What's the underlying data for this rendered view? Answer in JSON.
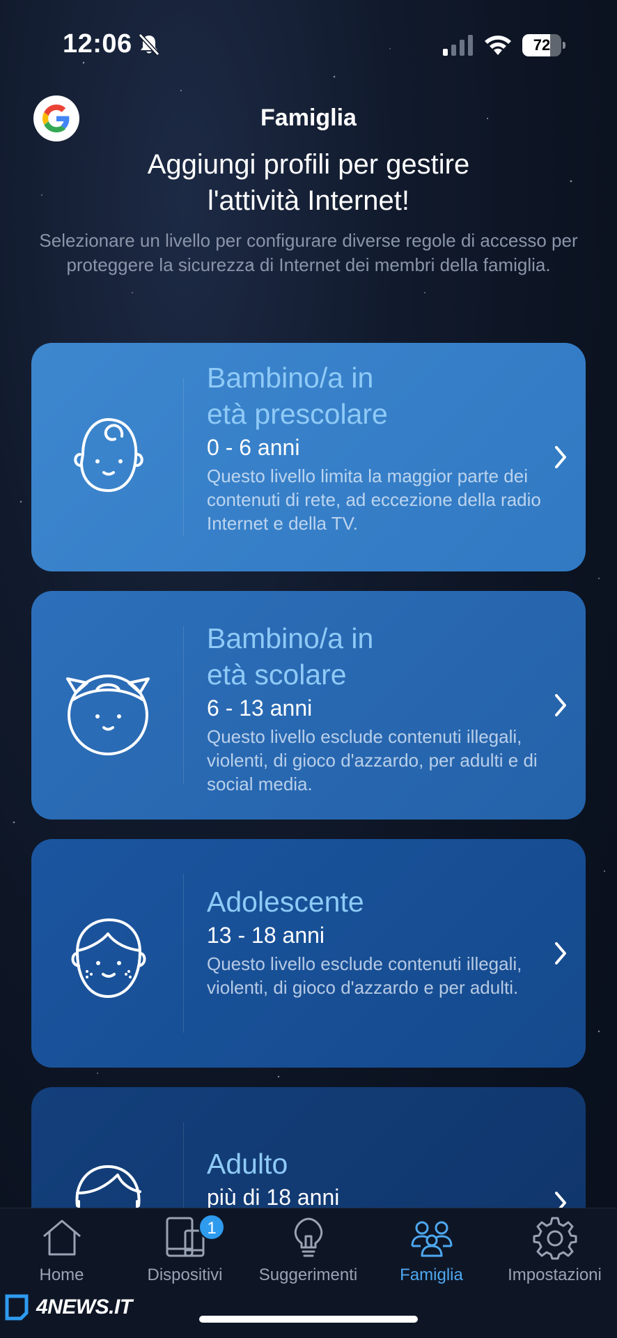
{
  "status_bar": {
    "time": "12:06",
    "battery_percent": "72",
    "battery_level": 0.72,
    "icons": [
      "bell-slash-icon",
      "signal-icon",
      "wifi-icon",
      "battery-icon"
    ]
  },
  "header": {
    "google_icon": "google-logo-icon",
    "title": "Famiglia",
    "headline_line1": "Aggiungi profili per gestire",
    "headline_line2": "l'attività Internet!",
    "subtext": "Selezionare un livello per configurare diverse regole di accesso per proteggere la sicurezza di Internet dei membri della famiglia."
  },
  "profiles": [
    {
      "icon": "baby-face-icon",
      "title_line1": "Bambino/a in",
      "title_line2": "età prescolare",
      "age": "0 - 6 anni",
      "description": "Questo livello limita la maggior parte dei contenuti di rete, ad eccezione della radio Internet e della TV."
    },
    {
      "icon": "girl-face-icon",
      "title_line1": "Bambino/a in",
      "title_line2": "età scolare",
      "age": "6 - 13 anni",
      "description": "Questo livello esclude contenuti illegali, violenti, di gioco d'azzardo, per adulti e di social media."
    },
    {
      "icon": "teen-face-icon",
      "title_line1": "Adolescente",
      "title_line2": "",
      "age": "13 - 18 anni",
      "description": "Questo livello esclude contenuti illegali, violenti, di gioco d'azzardo e per adulti."
    },
    {
      "icon": "adult-face-icon",
      "title_line1": "Adulto",
      "title_line2": "",
      "age": "più di 18 anni",
      "description": ""
    }
  ],
  "tab_bar": {
    "tabs": [
      {
        "label": "Home",
        "icon": "house-icon",
        "active": false
      },
      {
        "label": "Dispositivi",
        "icon": "devices-icon",
        "active": false,
        "badge": "1"
      },
      {
        "label": "Suggerimenti",
        "icon": "lightbulb-icon",
        "active": false
      },
      {
        "label": "Famiglia",
        "icon": "family-icon",
        "active": true
      },
      {
        "label": "Impostazioni",
        "icon": "gear-icon",
        "active": false
      }
    ]
  },
  "watermark": {
    "text": "4NEWS.IT",
    "icon": "4news-logo-icon"
  },
  "colors": {
    "accent": "#4ea8f0",
    "card_title": "#8fcaf7",
    "badge": "#2f9bef"
  }
}
